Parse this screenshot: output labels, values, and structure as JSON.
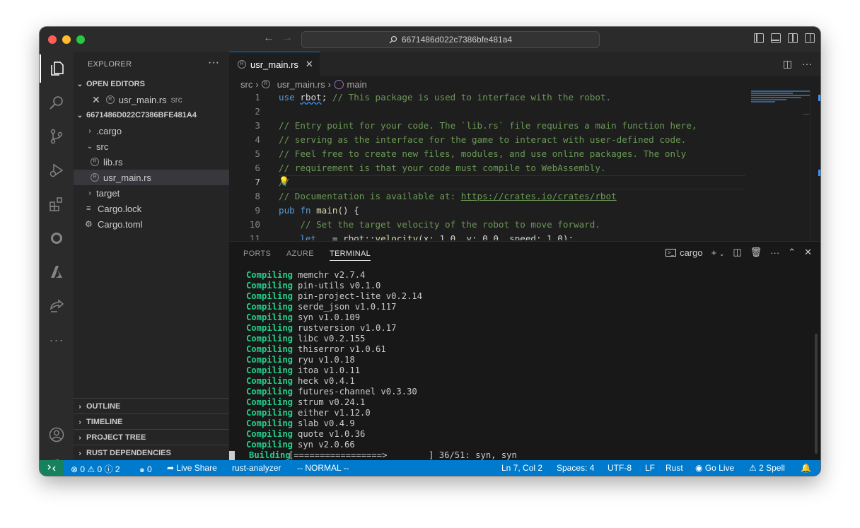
{
  "titlebar": {
    "search_text": "6671486d022c7386bfe481a4"
  },
  "sidebar": {
    "title": "EXPLORER",
    "more": "···",
    "open_editors_header": "OPEN EDITORS",
    "open_editor": {
      "name": "usr_main.rs",
      "dir": "src"
    },
    "workspace_header": "6671486D022C7386BFE481A4",
    "tree": {
      "cargo_dir": ".cargo",
      "src_dir": "src",
      "lib_rs": "lib.rs",
      "usr_main_rs": "usr_main.rs",
      "target_dir": "target",
      "cargo_lock": "Cargo.lock",
      "cargo_toml": "Cargo.toml"
    },
    "outline": "OUTLINE",
    "timeline": "TIMELINE",
    "project_tree": "PROJECT TREE",
    "rust_deps": "RUST DEPENDENCIES"
  },
  "editor": {
    "tab_label": "usr_main.rs",
    "breadcrumb": [
      "src",
      "usr_main.rs",
      "main"
    ],
    "lines": [
      {
        "n": "1",
        "parts": [
          {
            "c": "kw",
            "t": "use "
          },
          {
            "c": "pl squig",
            "t": "rbot"
          },
          {
            "c": "pl",
            "t": "; "
          },
          {
            "c": "cm",
            "t": "// This package is used to interface with the robot."
          }
        ]
      },
      {
        "n": "2",
        "parts": []
      },
      {
        "n": "3",
        "parts": [
          {
            "c": "cm",
            "t": "// Entry point for your code. The `lib.rs` file requires a main function here,"
          }
        ]
      },
      {
        "n": "4",
        "parts": [
          {
            "c": "cm",
            "t": "// serving as the interface for the game to interact with user-defined code."
          }
        ]
      },
      {
        "n": "5",
        "parts": [
          {
            "c": "cm",
            "t": "// Feel free to create new files, modules, and use online packages. The only"
          }
        ]
      },
      {
        "n": "6",
        "parts": [
          {
            "c": "cm",
            "t": "// requirement is that your code must compile to WebAssembly."
          }
        ]
      },
      {
        "n": "7",
        "parts": [
          {
            "c": "cm",
            "t": "//"
          }
        ]
      },
      {
        "n": "8",
        "parts": [
          {
            "c": "cm",
            "t": "// Documentation is available at: "
          },
          {
            "c": "lnk",
            "t": "https://crates.io/crates/rbot"
          }
        ]
      },
      {
        "n": "9",
        "parts": [
          {
            "c": "kw",
            "t": "pub fn "
          },
          {
            "c": "fn",
            "t": "main"
          },
          {
            "c": "pl",
            "t": "() {"
          }
        ]
      },
      {
        "n": "10",
        "parts": [
          {
            "c": "cm",
            "t": "    // Set the target velocity of the robot to move forward."
          }
        ]
      },
      {
        "n": "11",
        "parts": [
          {
            "c": "kw",
            "t": "    let "
          },
          {
            "c": "pl",
            "t": "_ = rbot::"
          },
          {
            "c": "fn",
            "t": "velocity"
          },
          {
            "c": "pl",
            "t": "(x: 1.0, y: 0.0, speed: 1.0);"
          }
        ]
      }
    ]
  },
  "panel": {
    "tabs": [
      "PORTS",
      "AZURE",
      "TERMINAL"
    ],
    "terminal_name": "cargo",
    "output": [
      {
        "k": "Compiling",
        "t": "memchr v2.7.4"
      },
      {
        "k": "Compiling",
        "t": "pin-utils v0.1.0"
      },
      {
        "k": "Compiling",
        "t": "pin-project-lite v0.2.14"
      },
      {
        "k": "Compiling",
        "t": "serde_json v1.0.117"
      },
      {
        "k": "Compiling",
        "t": "syn v1.0.109"
      },
      {
        "k": "Compiling",
        "t": "rustversion v1.0.17"
      },
      {
        "k": "Compiling",
        "t": "libc v0.2.155"
      },
      {
        "k": "Compiling",
        "t": "thiserror v1.0.61"
      },
      {
        "k": "Compiling",
        "t": "ryu v1.0.18"
      },
      {
        "k": "Compiling",
        "t": "itoa v1.0.11"
      },
      {
        "k": "Compiling",
        "t": "heck v0.4.1"
      },
      {
        "k": "Compiling",
        "t": "futures-channel v0.3.30"
      },
      {
        "k": "Compiling",
        "t": "strum v0.24.1"
      },
      {
        "k": "Compiling",
        "t": "either v1.12.0"
      },
      {
        "k": "Compiling",
        "t": "slab v0.4.9"
      },
      {
        "k": "Compiling",
        "t": "quote v1.0.36"
      },
      {
        "k": "Compiling",
        "t": "syn v2.0.66"
      }
    ],
    "building": {
      "k": "Building",
      "t": "[=================>        ] 36/51: syn, syn"
    }
  },
  "statusbar": {
    "problems": "⊗ 0 ⚠ 0 ⓘ 2",
    "ports": "๑ 0",
    "live_share": "Live Share",
    "rust_analyzer": "rust-analyzer",
    "vim_mode": "-- NORMAL --",
    "position": "Ln 7, Col 2",
    "spaces": "Spaces: 4",
    "encoding": "UTF-8",
    "eol": "LF",
    "language": "Rust",
    "go_live": "Go Live",
    "spell": "2 Spell"
  },
  "colors": {
    "accent": "#007acc",
    "remote": "#16825d",
    "terminal_green": "#23d18b"
  }
}
